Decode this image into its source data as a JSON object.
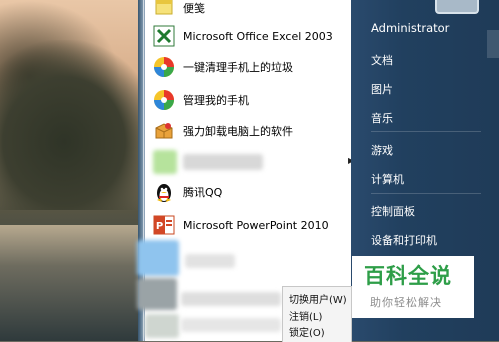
{
  "programs": [
    {
      "label": "便笺",
      "icon": "sticky-notes-icon"
    },
    {
      "label": "Microsoft Office Excel 2003",
      "icon": "excel-icon"
    },
    {
      "label": "一键清理手机上的垃圾",
      "icon": "colorful-ball-icon"
    },
    {
      "label": "管理我的手机",
      "icon": "colorful-ball-icon"
    },
    {
      "label": "强力卸载电脑上的软件",
      "icon": "uninstaller-box-icon"
    },
    {
      "label": "腾讯QQ",
      "icon": "qq-penguin-icon"
    },
    {
      "label": "Microsoft PowerPoint 2010",
      "icon": "powerpoint-icon"
    }
  ],
  "right_menu": {
    "user": "Administrator",
    "items": [
      "文档",
      "图片",
      "音乐",
      "游戏",
      "计算机",
      "控制面板",
      "设备和打印机"
    ]
  },
  "context_menu": [
    "切换用户(W)",
    "注销(L)",
    "锁定(O)"
  ],
  "watermark": {
    "title": "百科全说",
    "subtitle": "助你轻松解决"
  },
  "colors": {
    "right_pane": "#21405f",
    "watermark_green": "#2e9e48"
  }
}
